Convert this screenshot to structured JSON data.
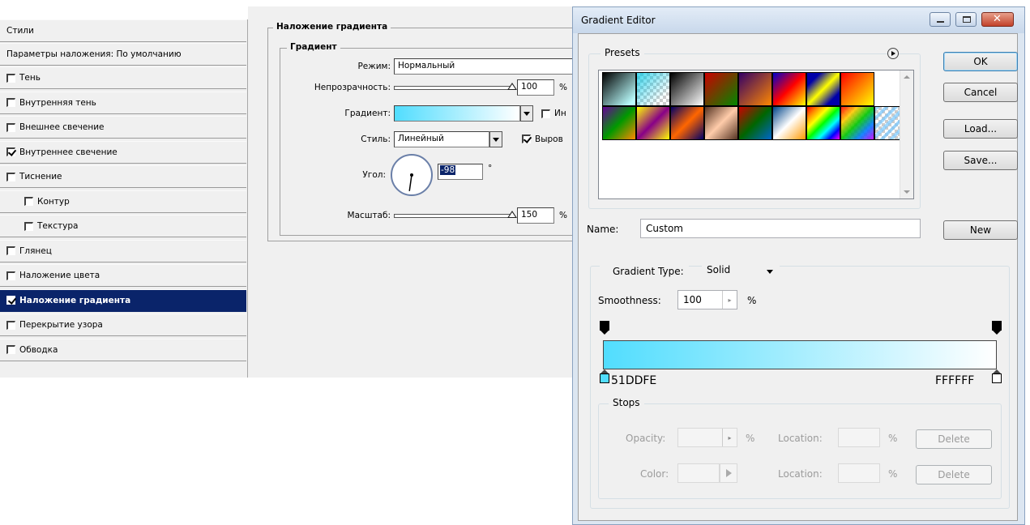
{
  "layer_styles": {
    "header": "Стили",
    "blending_options": "Параметры наложения: По умолчанию",
    "items": [
      {
        "label": "Тень",
        "checked": false,
        "indent": false,
        "active": false
      },
      {
        "label": "Внутренняя тень",
        "checked": false,
        "indent": false,
        "active": false
      },
      {
        "label": "Внешнее свечение",
        "checked": false,
        "indent": false,
        "active": false
      },
      {
        "label": "Внутреннее свечение",
        "checked": true,
        "indent": false,
        "active": false
      },
      {
        "label": "Тиснение",
        "checked": false,
        "indent": false,
        "active": false
      },
      {
        "label": "Контур",
        "checked": false,
        "indent": true,
        "active": false
      },
      {
        "label": "Текстура",
        "checked": false,
        "indent": true,
        "active": false
      },
      {
        "label": "Глянец",
        "checked": false,
        "indent": false,
        "active": false
      },
      {
        "label": "Наложение цвета",
        "checked": false,
        "indent": false,
        "active": false
      },
      {
        "label": "Наложение градиента",
        "checked": true,
        "indent": false,
        "active": true
      },
      {
        "label": "Перекрытие узора",
        "checked": false,
        "indent": false,
        "active": false
      },
      {
        "label": "Обводка",
        "checked": false,
        "indent": false,
        "active": false
      }
    ]
  },
  "gradient_overlay": {
    "title": "Наложение градиента",
    "group_title": "Градиент",
    "mode_label": "Режим:",
    "mode_value": "Нормальный",
    "opacity_label": "Непрозрачность:",
    "opacity_value": "100",
    "opacity_level": 1.0,
    "opacity_unit": "%",
    "gradient_label": "Градиент:",
    "reverse_label": "Ин",
    "style_label": "Стиль:",
    "style_value": "Линейный",
    "align_label": "Выров",
    "angle_label": "Угол:",
    "angle_value": "-98",
    "angle_unit": "°",
    "scale_label": "Масштаб:",
    "scale_value": "150",
    "scale_level": 1.0,
    "scale_unit": "%"
  },
  "gradient_editor": {
    "title": "Gradient Editor",
    "presets_label": "Presets",
    "buttons": {
      "ok": "OK",
      "cancel": "Cancel",
      "load": "Load...",
      "save": "Save...",
      "new": "New"
    },
    "name_label": "Name:",
    "name_value": "Custom",
    "type_label": "Gradient Type:",
    "type_value": "Solid",
    "smoothness_label": "Smoothness:",
    "smoothness_value": "100",
    "smoothness_unit": "%",
    "gradient_start_color": "#51DDFE",
    "gradient_end_color": "#FFFFFF",
    "start_stop_label": "51DDFE",
    "end_stop_label": "FFFFFF",
    "stops_label": "Stops",
    "opacity_label": "Opacity:",
    "opacity_unit": "%",
    "color_label": "Color:",
    "location_label": "Location:",
    "location_unit": "%",
    "delete_label": "Delete"
  }
}
